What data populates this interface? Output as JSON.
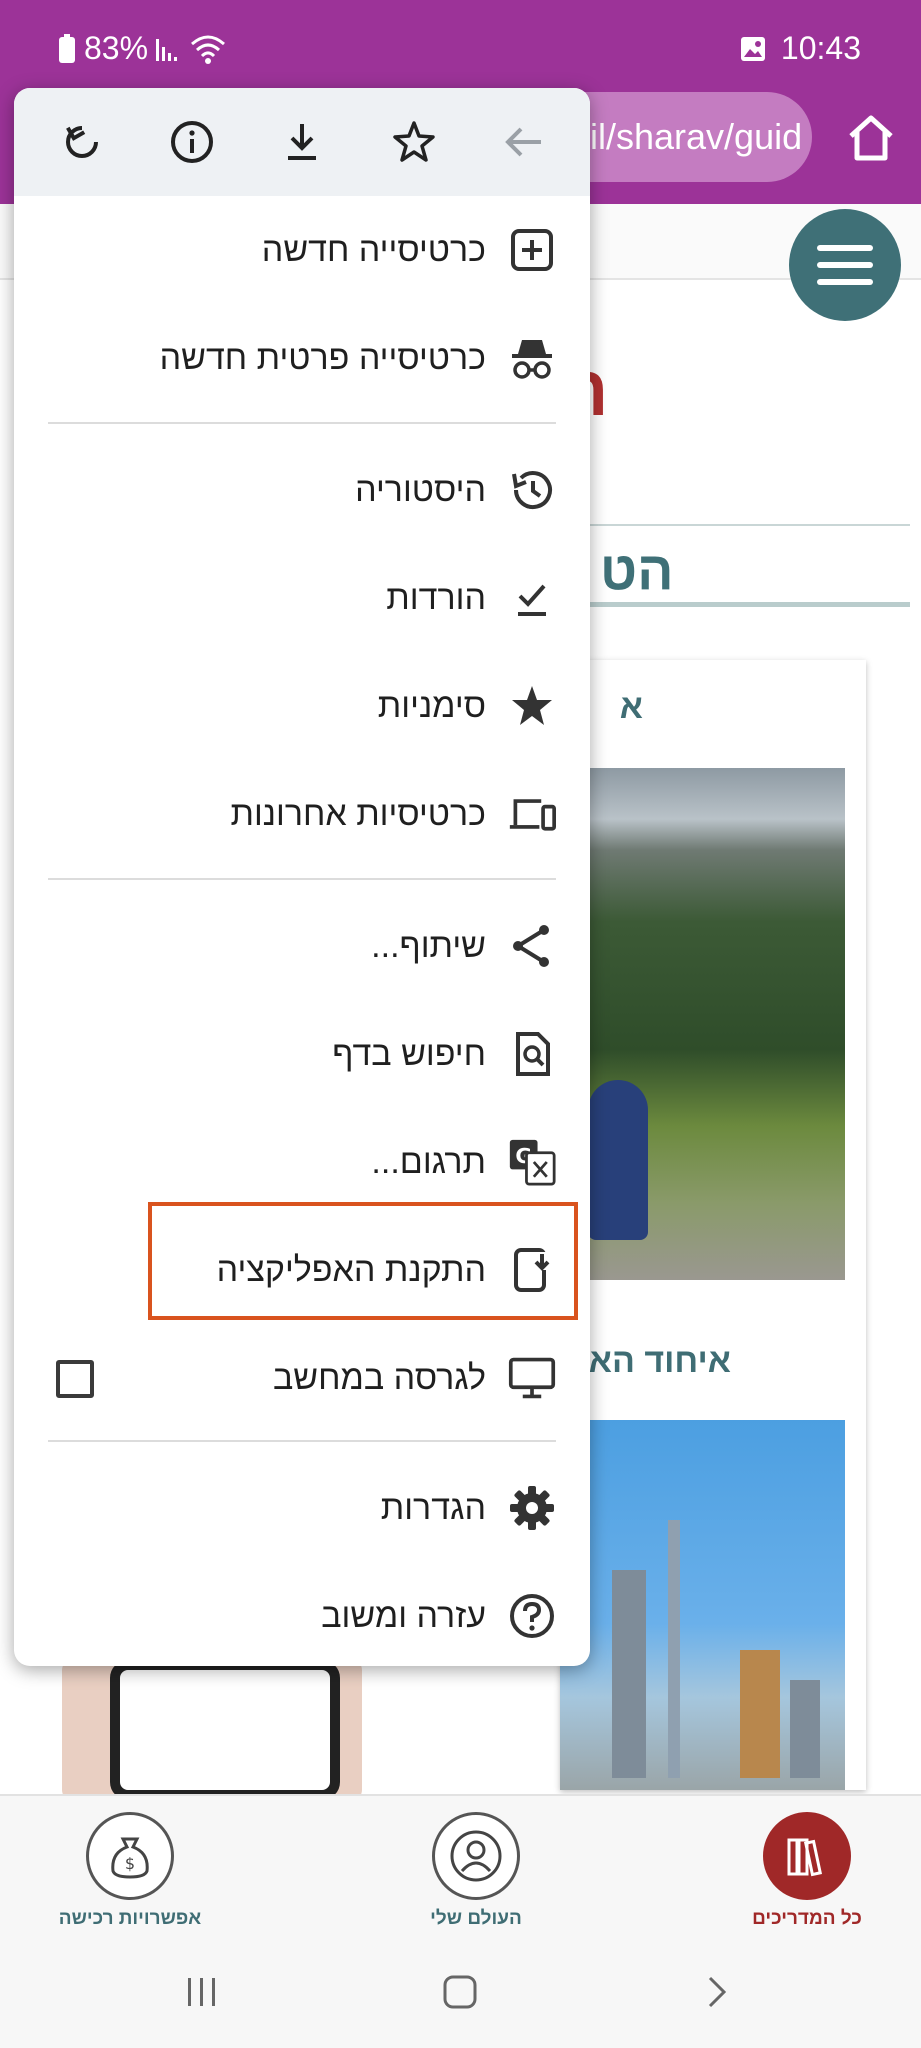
{
  "status_bar": {
    "battery": "83%",
    "time": "10:43"
  },
  "browser": {
    "url": "il/sharav/guid"
  },
  "page": {
    "heading_fragment": "הט",
    "red_fragment": "ה",
    "card1_title": "א",
    "card2_title": "איחוד הא"
  },
  "menu": {
    "toolbar_icons": [
      "back-arrow-icon",
      "star-icon",
      "download-icon",
      "info-icon",
      "refresh-icon"
    ],
    "items": {
      "new_tab": "כרטיסייה חדשה",
      "new_incognito": "כרטיסייה פרטית חדשה",
      "history": "היסטוריה",
      "downloads": "הורדות",
      "bookmarks": "סימניות",
      "recent_tabs": "כרטיסיות אחרונות",
      "share": "שיתוף...",
      "find_in_page": "חיפוש בדף",
      "translate": "תרגום...",
      "install_app": "התקנת האפליקציה",
      "desktop_site": "לגרסה במחשב",
      "settings": "הגדרות",
      "help": "עזרה ומשוב"
    },
    "highlight_color": "#d9531e"
  },
  "bottom_nav": {
    "purchase": "אפשרויות רכישה",
    "my_world": "העולם שלי",
    "all_guides": "כל המדריכים"
  },
  "colors": {
    "status_bar": "#9c3398",
    "accent_teal": "#3f7077",
    "accent_red": "#a02828"
  }
}
